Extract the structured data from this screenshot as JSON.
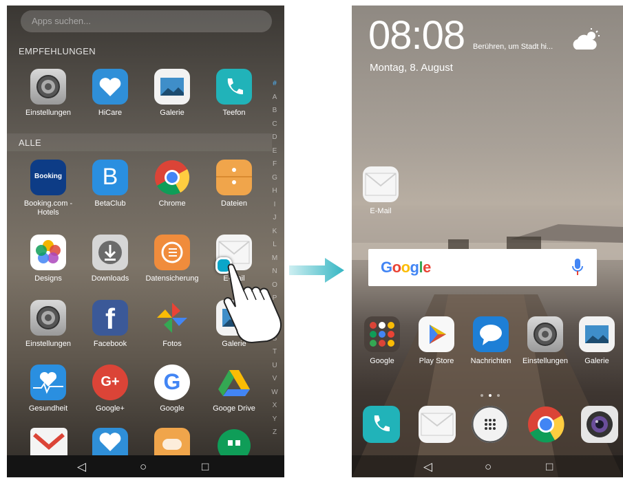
{
  "drawer": {
    "search_placeholder": "Apps suchen...",
    "section_recommendations": "EMPFEHLUNGEN",
    "section_all": "ALLE",
    "recommended": [
      {
        "label": "Einstellungen",
        "icon": "settings-gear-icon"
      },
      {
        "label": "HiCare",
        "icon": "hicare-heart-icon"
      },
      {
        "label": "Galerie",
        "icon": "gallery-icon"
      },
      {
        "label": "Teefon",
        "icon": "phone-icon"
      }
    ],
    "all_apps": [
      {
        "label": "Booking.com - Hotels",
        "icon": "booking-icon",
        "badge": "Booking"
      },
      {
        "label": "BetaClub",
        "icon": "betaclub-icon",
        "badge": "B"
      },
      {
        "label": "Chrome",
        "icon": "chrome-icon"
      },
      {
        "label": "Dateien",
        "icon": "files-icon"
      },
      {
        "label": "Designs",
        "icon": "designs-icon"
      },
      {
        "label": "Downloads",
        "icon": "downloads-icon"
      },
      {
        "label": "Datensicherung",
        "icon": "backup-icon"
      },
      {
        "label": "E-Mail",
        "icon": "mail-icon"
      },
      {
        "label": "Einstellungen",
        "icon": "settings-gear-icon"
      },
      {
        "label": "Facebook",
        "icon": "facebook-icon",
        "badge": "f"
      },
      {
        "label": "Fotos",
        "icon": "photos-pinwheel-icon"
      },
      {
        "label": "Galerie",
        "icon": "gallery-icon"
      },
      {
        "label": "Gesundheit",
        "icon": "health-icon"
      },
      {
        "label": "Google+",
        "icon": "google-plus-icon",
        "badge": "G+"
      },
      {
        "label": "Google",
        "icon": "google-icon",
        "badge": "G"
      },
      {
        "label": "Googe Drive",
        "icon": "drive-icon"
      }
    ],
    "alphabet": [
      "#",
      "A",
      "B",
      "C",
      "D",
      "E",
      "F",
      "G",
      "H",
      "I",
      "J",
      "K",
      "L",
      "M",
      "N",
      "O",
      "P",
      "Q",
      "R",
      "S",
      "T",
      "U",
      "V",
      "W",
      "X",
      "Y",
      "Z"
    ]
  },
  "navbar": {
    "back": "◁",
    "home": "○",
    "recents": "□"
  },
  "lockscreen": {
    "time": "08:08",
    "time_hint": "Berühren, um Stadt hi...",
    "date": "Montag, 8. August",
    "weather_icon": "partly-cloudy-icon",
    "desktop_app": {
      "label": "E-Mail",
      "icon": "mail-icon"
    },
    "google_bar": {
      "logo": "Google",
      "icon": "microphone-icon"
    },
    "home_apps": [
      {
        "label": "Google",
        "icon": "google-folder-icon"
      },
      {
        "label": "Play Store",
        "icon": "play-store-icon"
      },
      {
        "label": "Nachrichten",
        "icon": "messages-icon"
      },
      {
        "label": "Einstellungen",
        "icon": "settings-gear-icon"
      },
      {
        "label": "Galerie",
        "icon": "gallery-icon"
      }
    ],
    "dock": [
      {
        "icon": "phone-icon"
      },
      {
        "icon": "mail-icon"
      },
      {
        "icon": "app-drawer-icon"
      },
      {
        "icon": "chrome-icon"
      },
      {
        "icon": "camera-icon"
      }
    ]
  },
  "colors": {
    "accent_blue": "#4fb7ff",
    "arrow": "#35b6c3",
    "google_blue": "#4285f4",
    "google_red": "#ea4335",
    "google_yellow": "#fbbc05",
    "google_green": "#34a853"
  }
}
